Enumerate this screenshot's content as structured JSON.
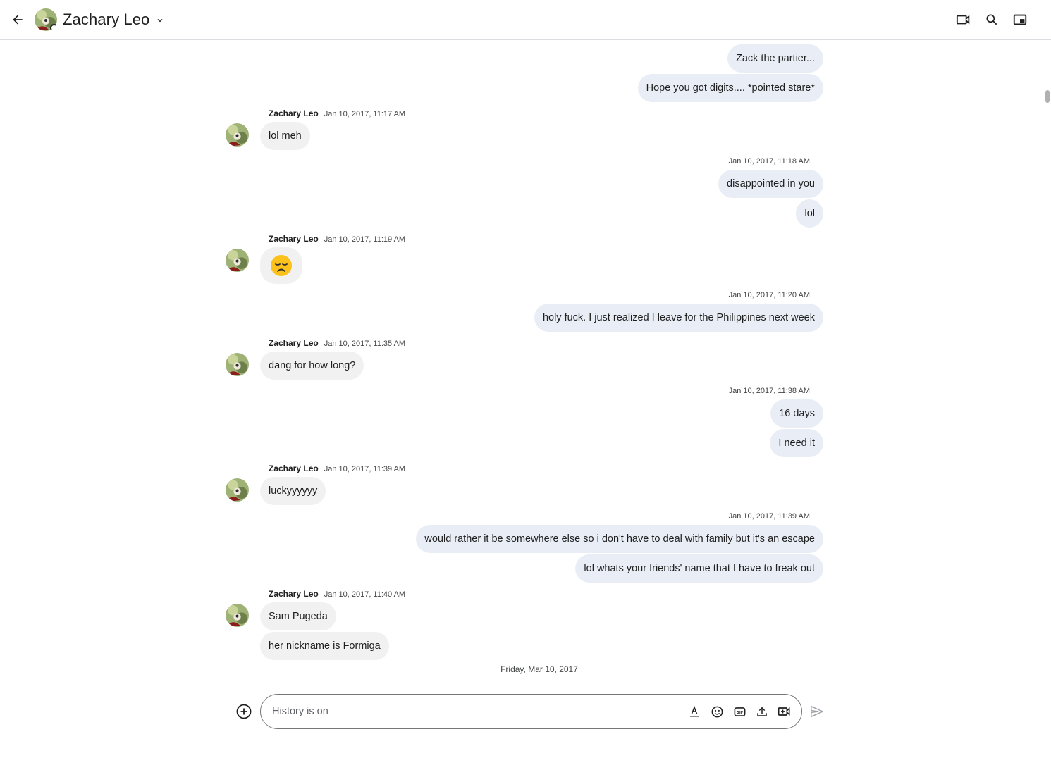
{
  "header": {
    "contact_name": "Zachary Leo",
    "icons": [
      "back-arrow-icon",
      "avatar",
      "chevron-down-icon",
      "video-call-icon",
      "search-icon",
      "picture-in-picture-icon"
    ]
  },
  "messages": [
    {
      "id": "m1",
      "direction": "out",
      "text": "Zack the partier..."
    },
    {
      "id": "m2",
      "direction": "out",
      "text": "Hope you got digits.... *pointed stare*"
    },
    {
      "id": "g1",
      "sender": "Zachary Leo",
      "time": "Jan 10, 2017, 11:17 AM"
    },
    {
      "id": "m3",
      "direction": "in",
      "text": "lol meh"
    },
    {
      "id": "g2",
      "time": "Jan 10, 2017, 11:18 AM"
    },
    {
      "id": "m4",
      "direction": "out",
      "text": "disappointed in you"
    },
    {
      "id": "m5",
      "direction": "out",
      "text": "lol"
    },
    {
      "id": "g3",
      "sender": "Zachary Leo",
      "time": "Jan 10, 2017, 11:19 AM"
    },
    {
      "id": "m6",
      "direction": "in",
      "text": "😞"
    },
    {
      "id": "g4",
      "time": "Jan 10, 2017, 11:20 AM"
    },
    {
      "id": "m7",
      "direction": "out",
      "text": "holy fuck. I just realized I leave for the Philippines next week"
    },
    {
      "id": "g5",
      "sender": "Zachary Leo",
      "time": "Jan 10, 2017, 11:35 AM"
    },
    {
      "id": "m8",
      "direction": "in",
      "text": "dang for how long?"
    },
    {
      "id": "g6",
      "time": "Jan 10, 2017, 11:38 AM"
    },
    {
      "id": "m9",
      "direction": "out",
      "text": "16 days"
    },
    {
      "id": "m10",
      "direction": "out",
      "text": "I need it"
    },
    {
      "id": "g7",
      "sender": "Zachary Leo",
      "time": "Jan 10, 2017, 11:39 AM"
    },
    {
      "id": "m11",
      "direction": "in",
      "text": "luckyyyyyy"
    },
    {
      "id": "g8",
      "time": "Jan 10, 2017, 11:39 AM"
    },
    {
      "id": "m12",
      "direction": "out",
      "text": "would rather it be somewhere else so i don't have to deal with family but it's an escape"
    },
    {
      "id": "m13",
      "direction": "out",
      "text": "lol whats your friends' name that I have to freak out"
    },
    {
      "id": "g9",
      "sender": "Zachary Leo",
      "time": "Jan 10, 2017, 11:40 AM"
    },
    {
      "id": "m14",
      "direction": "in",
      "text": "Sam Pugeda"
    },
    {
      "id": "m15",
      "direction": "in",
      "text": "her nickname is Formiga"
    }
  ],
  "day_separator": "Friday, Mar 10, 2017",
  "composer": {
    "placeholder": "History is on",
    "tools": [
      "text-format-icon",
      "emoji-icon",
      "gif-icon",
      "upload-icon",
      "video-meeting-icon"
    ],
    "add_icon": "add-circle-icon",
    "send_icon": "send-icon"
  },
  "colors": {
    "outgoing_bubble": "#e9eef6",
    "incoming_bubble": "#f1f1f1",
    "divider": "#dadce0"
  }
}
